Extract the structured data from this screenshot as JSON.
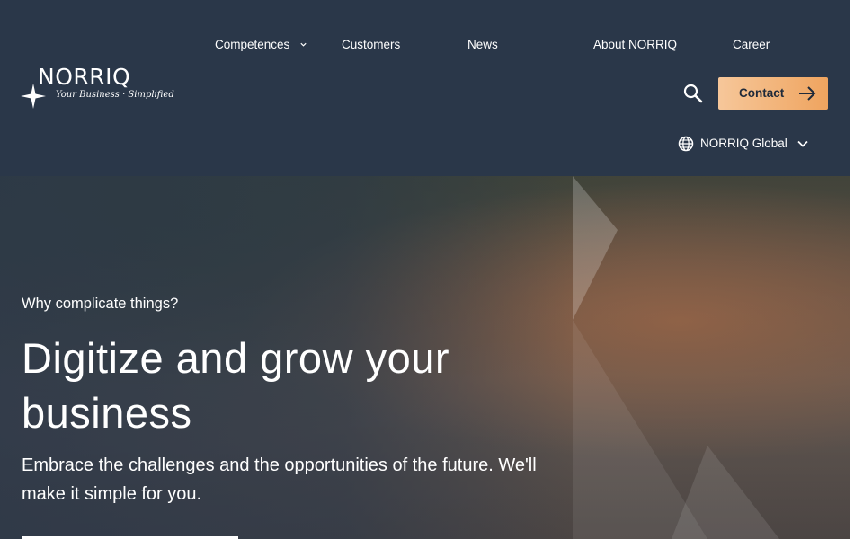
{
  "brand": {
    "name": "NORRIQ",
    "tagline": "Your Business · Simplified"
  },
  "nav": {
    "items": [
      {
        "label": "Competences",
        "has_dropdown": true
      },
      {
        "label": "Customers"
      },
      {
        "label": "News"
      },
      {
        "label": "About NORRIQ"
      },
      {
        "label": "Career"
      }
    ]
  },
  "header": {
    "contact_label": "Contact",
    "region_label": "NORRIQ Global"
  },
  "hero": {
    "eyebrow": "Why complicate things?",
    "title": "Digitize and grow your business",
    "subtitle": "Embrace the challenges and the opportunities of the future. We'll make it simple for you."
  },
  "colors": {
    "header_bg": "#2a3749",
    "accent_from": "#f6c79a",
    "accent_to": "#efa45f"
  },
  "icons": [
    "star-logo-icon",
    "chevron-down-icon",
    "search-icon",
    "arrow-right-icon",
    "globe-icon"
  ]
}
